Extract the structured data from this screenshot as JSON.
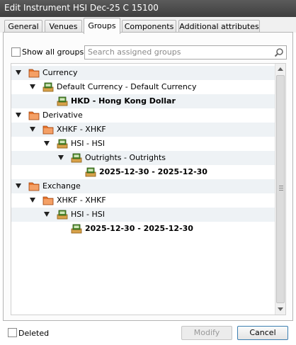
{
  "window": {
    "title": "Edit Instrument HSI Dec-25 C 15100"
  },
  "tabs": [
    {
      "label": "General"
    },
    {
      "label": "Venues"
    },
    {
      "label": "Groups",
      "active": true
    },
    {
      "label": "Components"
    },
    {
      "label": "Additional attributes"
    }
  ],
  "groups": {
    "show_all_label": "Show all groups",
    "show_all_checked": false,
    "search_placeholder": "Search assigned groups"
  },
  "tree": [
    {
      "label": "Currency",
      "icon": "folder-icon",
      "level": 0,
      "expanded": true,
      "bold": false
    },
    {
      "label": "Default Currency - Default Currency",
      "icon": "group-icon",
      "level": 1,
      "expanded": true,
      "bold": false
    },
    {
      "label": "HKD - Hong Kong Dollar",
      "icon": "group-icon",
      "level": 2,
      "expanded": false,
      "bold": true
    },
    {
      "label": "Derivative",
      "icon": "folder-icon",
      "level": 0,
      "expanded": true,
      "bold": false
    },
    {
      "label": "XHKF - XHKF",
      "icon": "folder-icon",
      "level": 1,
      "expanded": true,
      "bold": false
    },
    {
      "label": "HSI - HSI",
      "icon": "group-icon",
      "level": 2,
      "expanded": true,
      "bold": false
    },
    {
      "label": "Outrights - Outrights",
      "icon": "group-icon",
      "level": 3,
      "expanded": true,
      "bold": false
    },
    {
      "label": "2025-12-30 - 2025-12-30",
      "icon": "group-icon",
      "level": 4,
      "expanded": false,
      "bold": true
    },
    {
      "label": "Exchange",
      "icon": "folder-icon",
      "level": 0,
      "expanded": true,
      "bold": false
    },
    {
      "label": "XHKF - XHKF",
      "icon": "folder-icon",
      "level": 1,
      "expanded": true,
      "bold": false
    },
    {
      "label": "HSI - HSI",
      "icon": "group-icon",
      "level": 2,
      "expanded": true,
      "bold": false
    },
    {
      "label": "2025-12-30 - 2025-12-30",
      "icon": "group-icon",
      "level": 3,
      "expanded": false,
      "bold": true
    }
  ],
  "footer": {
    "deleted_label": "Deleted",
    "deleted_checked": false,
    "modify_label": "Modify",
    "cancel_label": "Cancel"
  },
  "colors": {
    "folder": "#e8742c",
    "group": "#4f8a2d",
    "row_alt": "#eef2f5"
  }
}
